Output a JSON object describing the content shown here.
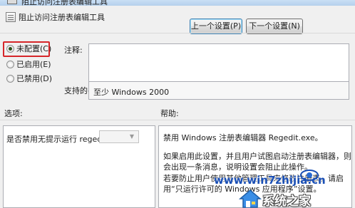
{
  "window": {
    "title": "阻止访问注册表编辑工具"
  },
  "header": {
    "policy_name": "阻止访问注册表编辑工具",
    "prev_button": "上一个设置(P)",
    "next_button": "下一个设置(N)"
  },
  "state": {
    "options": [
      {
        "label": "未配置(C)",
        "selected": true
      },
      {
        "label": "已启用(E)",
        "selected": false
      },
      {
        "label": "已禁用(D)",
        "selected": false
      }
    ]
  },
  "comment": {
    "label": "注释:",
    "value": ""
  },
  "platform": {
    "label": "支持的平台:",
    "value": "至少 Windows 2000"
  },
  "options_section": {
    "label": "选项:",
    "item_label": "是否禁用无提示运行 regedit？",
    "dropdown_value": ""
  },
  "help_section": {
    "label": "帮助:",
    "paragraphs": [
      "禁用 Windows 注册表编辑器 Regedit.exe。",
      "如果启用此设置，并且用户试图启动注册表编辑器，则会出现一条消息，说明设置会阻止此操作。",
      "若要防止用户使用其他管理工具来修改注册表，请启用“只运行许可的 Windows 应用程序”设置。"
    ]
  },
  "watermark": {
    "url": "www.win7zhijia.cn",
    "site_name": "系统之家"
  },
  "colors": {
    "highlight_border": "#d6262a",
    "watermark_blue": "#1a4fb5"
  }
}
